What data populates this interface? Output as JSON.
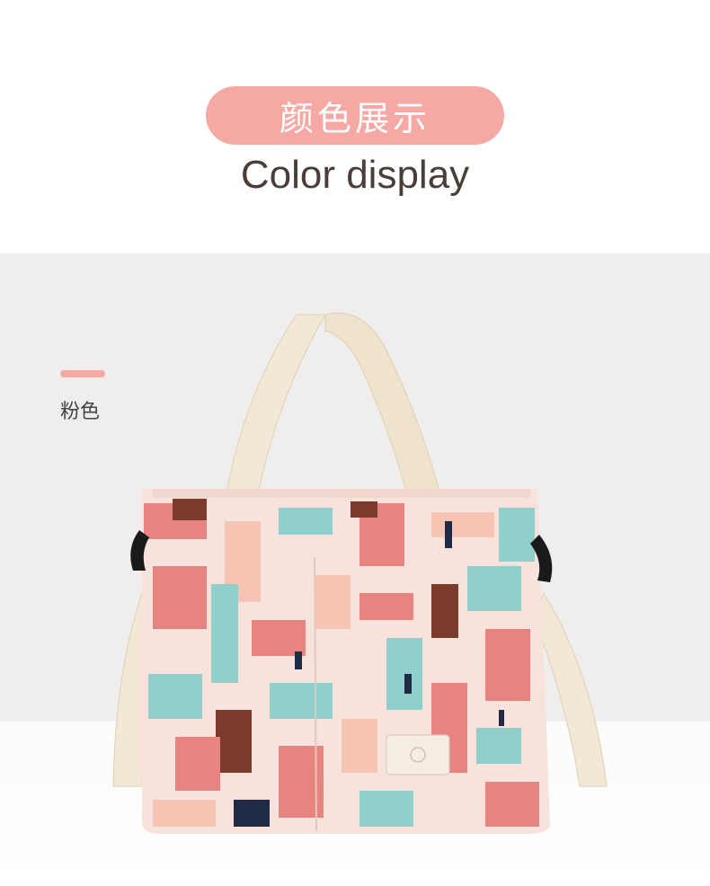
{
  "header": {
    "title_cn": "颜色展示",
    "title_en": "Color display"
  },
  "swatch": {
    "label": "粉色",
    "color": "#f5a8a4"
  },
  "product": {
    "image": "tote-bag-photo",
    "palette": [
      "#f7e3dc",
      "#e8847f",
      "#f5c4b2",
      "#8fd0cc",
      "#7a3b2a",
      "#1f2a44",
      "#f2e8d5"
    ]
  }
}
